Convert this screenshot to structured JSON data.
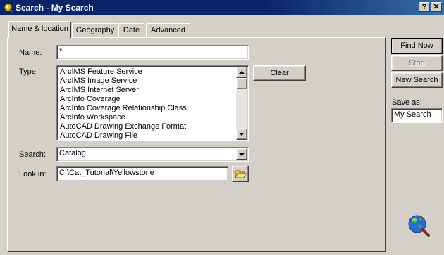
{
  "window": {
    "title": "Search - My Search",
    "help_label": "?",
    "close_label": "✕"
  },
  "tabs": [
    {
      "label": "Name & location"
    },
    {
      "label": "Geography"
    },
    {
      "label": "Date"
    },
    {
      "label": "Advanced"
    }
  ],
  "form": {
    "name_label": "Name:",
    "name_value": "*",
    "type_label": "Type:",
    "type_items": [
      "ArcIMS Feature Service",
      "ArcIMS Image Service",
      "ArcIMS Internet Server",
      "ArcInfo Coverage",
      "ArcInfo Coverage Relationship Class",
      "ArcInfo Workspace",
      "AutoCAD Drawing Exchange Format",
      "AutoCAD Drawing File"
    ],
    "clear_label": "Clear",
    "search_label": "Search:",
    "search_value": "Catalog",
    "lookin_label": "Look in:",
    "lookin_value": "C:\\Cat_Tutorial\\Yellowstone"
  },
  "actions": {
    "find_now": "Find Now",
    "stop": "Stop",
    "new_search": "New Search",
    "save_as_label": "Save as:",
    "save_as_value": "My Search"
  },
  "icons": {
    "title": "search-icon",
    "folder": "open-folder-icon",
    "globe": "globe-magnifier-icon"
  }
}
